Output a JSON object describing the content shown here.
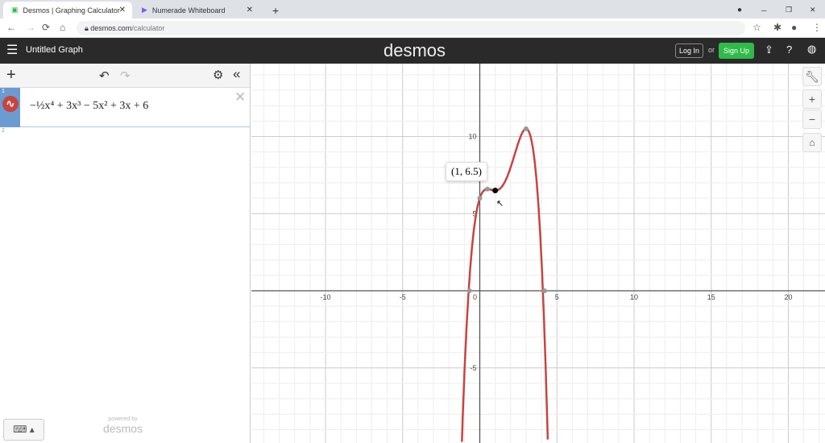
{
  "browser": {
    "tabs": [
      {
        "title": "Desmos | Graphing Calculator"
      },
      {
        "title": "Numerade Whiteboard"
      }
    ],
    "url_domain": "desmos.com",
    "url_path": "/calculator"
  },
  "header": {
    "title": "Untitled Graph",
    "logo": "desmos",
    "login": "Log In",
    "or": "or",
    "signup": "Sign Up"
  },
  "expressions": [
    {
      "index": "1",
      "latex_display": "−½x⁴ + 3x³ − 5x² + 3x + 6",
      "color": "#c74440"
    },
    {
      "index": "2",
      "latex_display": ""
    }
  ],
  "powered_by": "powered by",
  "powered_logo": "desmos",
  "graph": {
    "xticks": [
      "-10",
      "-5",
      "0",
      "5",
      "10",
      "15",
      "20"
    ],
    "yticks": [
      "10",
      "5",
      "-5"
    ],
    "point_label": "(1, 6.5)",
    "point": [
      1,
      6.5
    ],
    "curve_color": "#c74440",
    "coefficients": [
      -0.5,
      3,
      -5,
      3,
      6
    ]
  }
}
